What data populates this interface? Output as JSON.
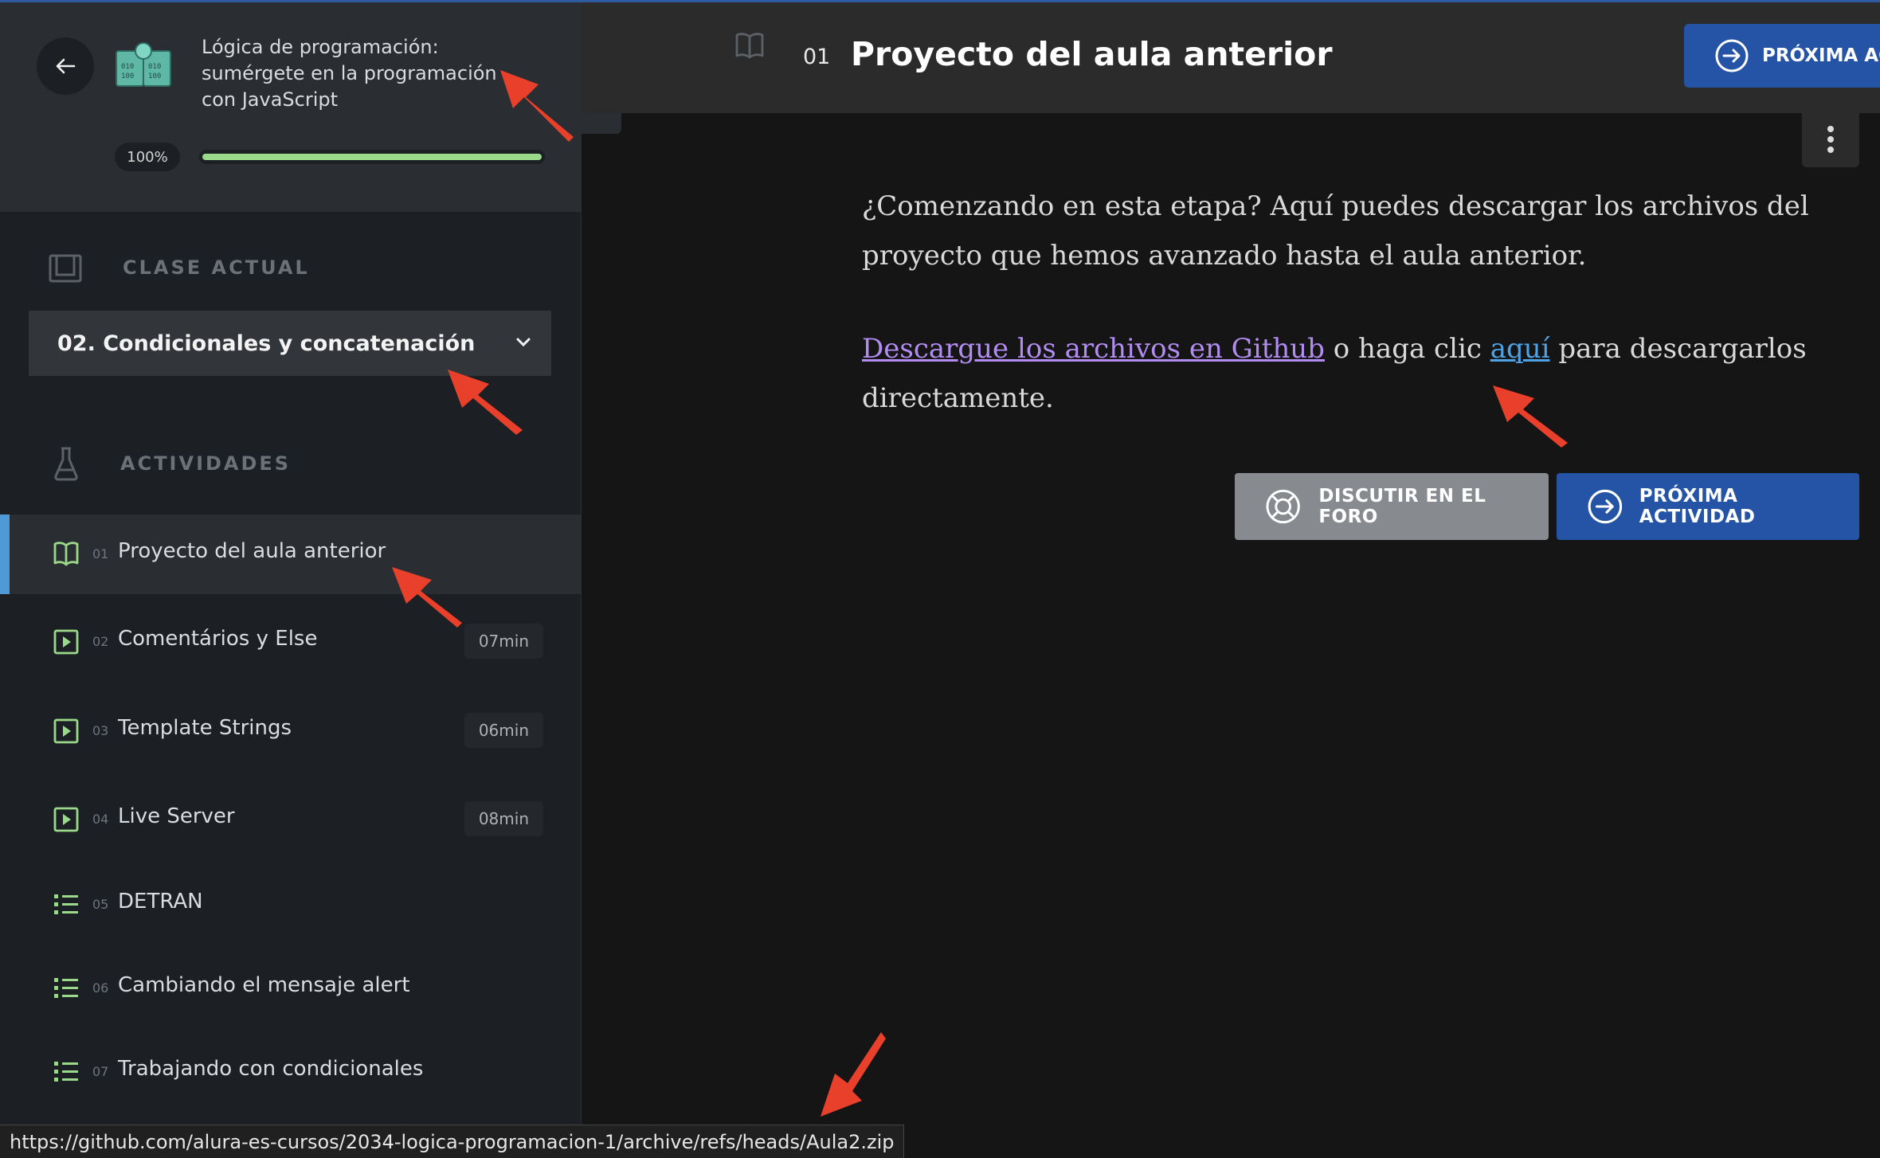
{
  "course": {
    "title": "Lógica de programación: sumérgete en la programación con JavaScript",
    "progress_label": "100%",
    "progress": 1.0
  },
  "sidebar": {
    "current_class_label": "CLASE ACTUAL",
    "current_class": "02. Condicionales y concatenación",
    "activities_label": "ACTIVIDADES",
    "items": [
      {
        "num": "01",
        "label": "Proyecto del aula anterior",
        "icon": "book-icon",
        "duration": "",
        "active": true
      },
      {
        "num": "02",
        "label": "Comentários y Else",
        "icon": "video-icon",
        "duration": "07min"
      },
      {
        "num": "03",
        "label": "Template Strings",
        "icon": "video-icon",
        "duration": "06min"
      },
      {
        "num": "04",
        "label": "Live Server",
        "icon": "video-icon",
        "duration": "08min"
      },
      {
        "num": "05",
        "label": "DETRAN",
        "icon": "list-icon",
        "duration": ""
      },
      {
        "num": "06",
        "label": "Cambiando el mensaje alert",
        "icon": "list-icon",
        "duration": ""
      },
      {
        "num": "07",
        "label": "Trabajando con condicionales",
        "icon": "list-icon",
        "duration": ""
      }
    ]
  },
  "header": {
    "num": "01",
    "title": "Proyecto del aula anterior",
    "next_button": "PRÓXIMA AC"
  },
  "content": {
    "paragraph1": "¿Comenzando en esta etapa? Aquí puedes descargar los archivos del proyecto que hemos avanzado hasta el aula anterior.",
    "link_github": "Descargue los archivos en Github",
    "mid_text": " o haga clic ",
    "link_here": "aquí",
    "tail_text": " para descargarlos directamente."
  },
  "buttons": {
    "forum": "DISCUTIR EN EL FORO",
    "next": "PRÓXIMA ACTIVIDAD"
  },
  "status_bar": {
    "url": "https://github.com/alura-es-cursos/2034-logica-programacion-1/archive/refs/heads/Aula2.zip"
  },
  "colors": {
    "accent_blue": "#2553a6",
    "progress_green": "#9ad98a",
    "annotation_red": "#e8402a"
  }
}
